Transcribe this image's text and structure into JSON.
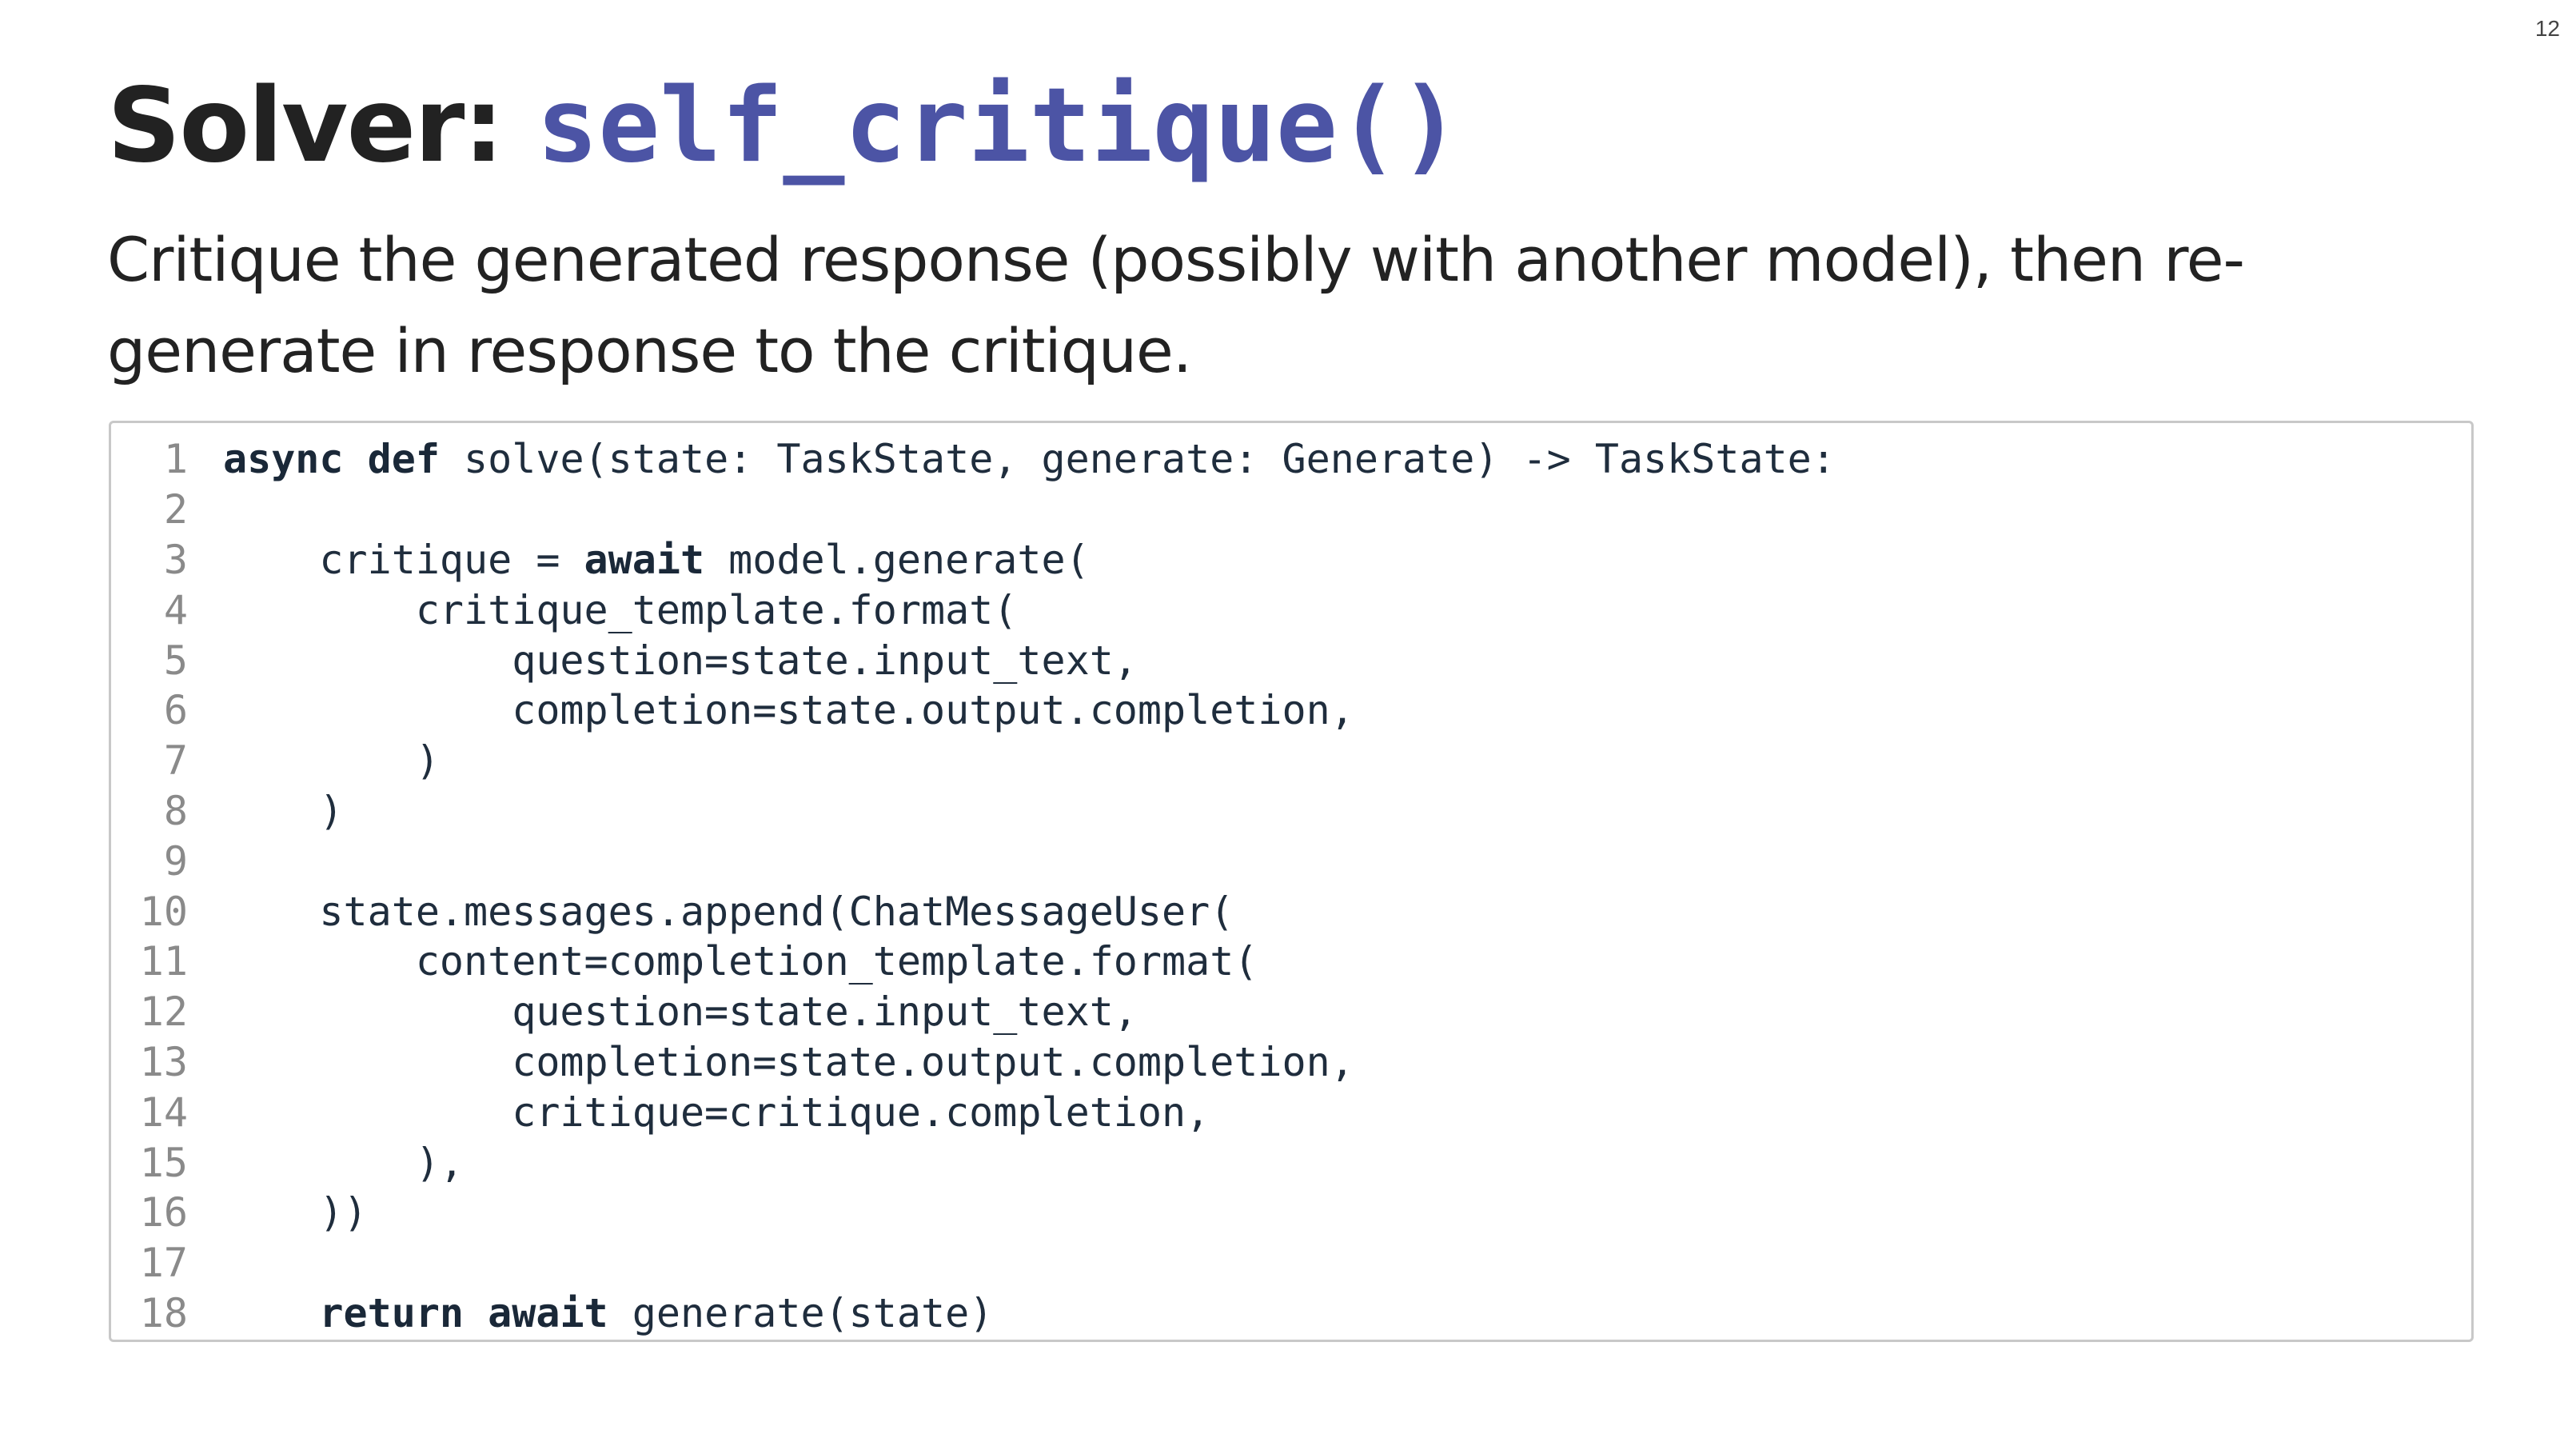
{
  "slide": {
    "page_number": "12",
    "title_prefix": "Solver: ",
    "title_code": "self_critique()",
    "subtitle": "Critique the generated response (possibly with another model), then re-generate in response to the critique."
  },
  "code": {
    "lines": [
      {
        "num": "1",
        "segments": [
          {
            "t": "async def",
            "kw": true
          },
          {
            "t": " solve(state: TaskState, generate: Generate) -> TaskState:"
          }
        ]
      },
      {
        "num": "2",
        "segments": []
      },
      {
        "num": "3",
        "segments": [
          {
            "t": "    critique = "
          },
          {
            "t": "await",
            "kw": true
          },
          {
            "t": " model.generate("
          }
        ]
      },
      {
        "num": "4",
        "segments": [
          {
            "t": "        critique_template.format("
          }
        ]
      },
      {
        "num": "5",
        "segments": [
          {
            "t": "            question=state.input_text,"
          }
        ]
      },
      {
        "num": "6",
        "segments": [
          {
            "t": "            completion=state.output.completion,"
          }
        ]
      },
      {
        "num": "7",
        "segments": [
          {
            "t": "        )"
          }
        ]
      },
      {
        "num": "8",
        "segments": [
          {
            "t": "    )"
          }
        ]
      },
      {
        "num": "9",
        "segments": []
      },
      {
        "num": "10",
        "segments": [
          {
            "t": "    state.messages.append(ChatMessageUser("
          }
        ]
      },
      {
        "num": "11",
        "segments": [
          {
            "t": "        content=completion_template.format("
          }
        ]
      },
      {
        "num": "12",
        "segments": [
          {
            "t": "            question=state.input_text,"
          }
        ]
      },
      {
        "num": "13",
        "segments": [
          {
            "t": "            completion=state.output.completion,"
          }
        ]
      },
      {
        "num": "14",
        "segments": [
          {
            "t": "            critique=critique.completion,"
          }
        ]
      },
      {
        "num": "15",
        "segments": [
          {
            "t": "        ),"
          }
        ]
      },
      {
        "num": "16",
        "segments": [
          {
            "t": "    ))"
          }
        ]
      },
      {
        "num": "17",
        "segments": []
      },
      {
        "num": "18",
        "segments": [
          {
            "t": "    "
          },
          {
            "t": "return await",
            "kw": true
          },
          {
            "t": " generate(state)"
          }
        ]
      }
    ]
  },
  "colors": {
    "title_code": "#4c54a5",
    "text": "#222222",
    "line_number": "#8a8a8a",
    "border": "#c8c8c8"
  }
}
